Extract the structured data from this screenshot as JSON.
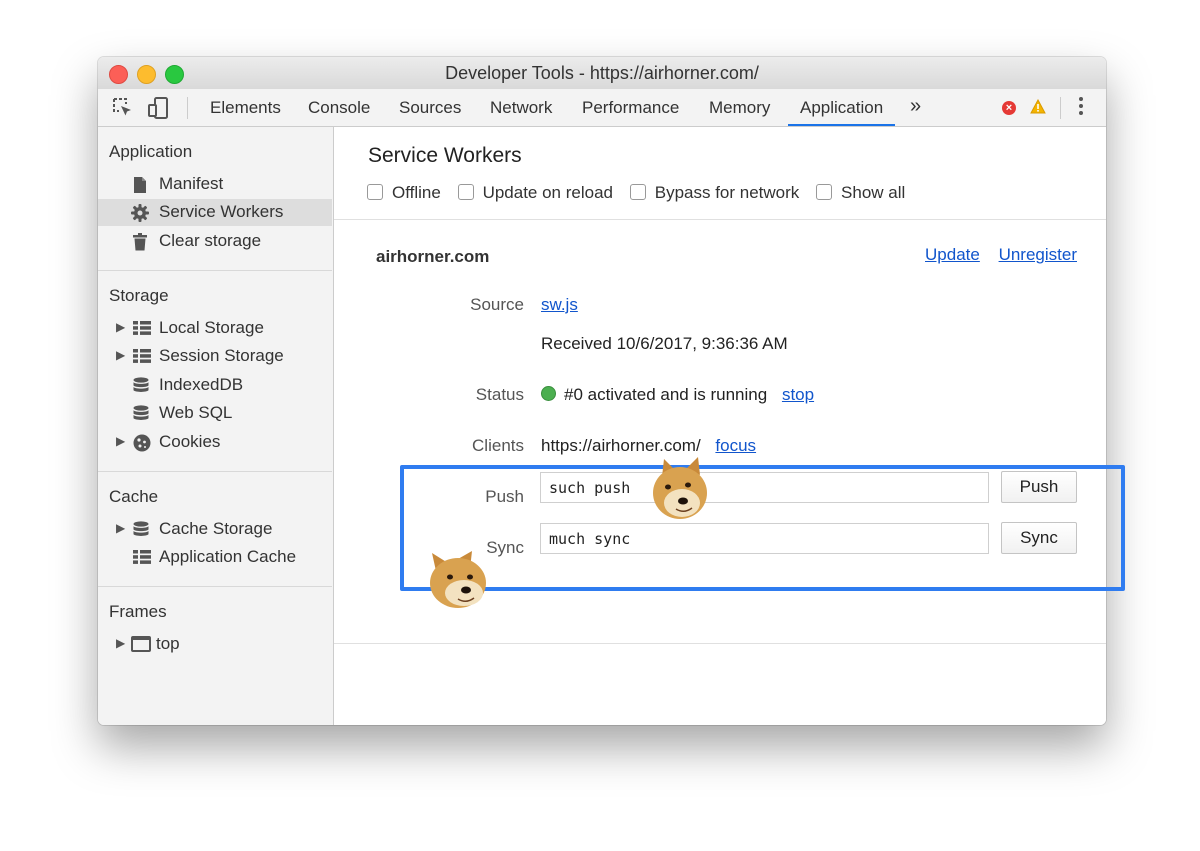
{
  "window": {
    "title": "Developer Tools - https://airhorner.com/"
  },
  "toolbar": {
    "tabs": [
      {
        "label": "Elements"
      },
      {
        "label": "Console"
      },
      {
        "label": "Sources"
      },
      {
        "label": "Network"
      },
      {
        "label": "Performance"
      },
      {
        "label": "Memory"
      },
      {
        "label": "Application",
        "active": true
      }
    ],
    "more": "»",
    "error_icon": "×",
    "icons": [
      "inspect-element-icon",
      "device-toolbar-icon",
      "error-icon",
      "warning-icon",
      "more-menu-icon"
    ]
  },
  "sidebar": {
    "sections": [
      {
        "title": "Application",
        "items": [
          {
            "label": "Manifest",
            "icon": "document-icon"
          },
          {
            "label": "Service Workers",
            "icon": "gear-icon",
            "selected": true
          },
          {
            "label": "Clear storage",
            "icon": "trash-icon"
          }
        ]
      },
      {
        "title": "Storage",
        "items": [
          {
            "label": "Local Storage",
            "icon": "grid-icon",
            "expandable": true
          },
          {
            "label": "Session Storage",
            "icon": "grid-icon",
            "expandable": true
          },
          {
            "label": "IndexedDB",
            "icon": "database-icon"
          },
          {
            "label": "Web SQL",
            "icon": "database-icon"
          },
          {
            "label": "Cookies",
            "icon": "cookie-icon",
            "expandable": true
          }
        ]
      },
      {
        "title": "Cache",
        "items": [
          {
            "label": "Cache Storage",
            "icon": "database-icon",
            "expandable": true
          },
          {
            "label": "Application Cache",
            "icon": "grid-icon"
          }
        ]
      },
      {
        "title": "Frames",
        "items": [
          {
            "label": "top",
            "icon": "frame-icon",
            "expandable": true
          }
        ]
      }
    ]
  },
  "main": {
    "title": "Service Workers",
    "options": [
      {
        "label": "Offline",
        "checked": false
      },
      {
        "label": "Update on reload",
        "checked": false
      },
      {
        "label": "Bypass for network",
        "checked": false
      },
      {
        "label": "Show all",
        "checked": false
      }
    ],
    "worker": {
      "origin": "airhorner.com",
      "update_label": "Update",
      "unregister_label": "Unregister",
      "source_label": "Source",
      "source_link": "sw.js",
      "received": "Received 10/6/2017, 9:36:36 AM",
      "status_label": "Status",
      "status_text": "#0 activated and is running",
      "stop_label": "stop",
      "clients_label": "Clients",
      "client_url": "https://airhorner.com/",
      "focus_label": "focus",
      "push_label": "Push",
      "push_value": "such push",
      "push_button": "Push",
      "sync_label": "Sync",
      "sync_value": "much sync",
      "sync_button": "Sync"
    }
  },
  "colors": {
    "highlight": "#2f7cf0",
    "link": "#1155cc",
    "status_running": "#4caf50",
    "active_tab": "#1a73e8"
  }
}
